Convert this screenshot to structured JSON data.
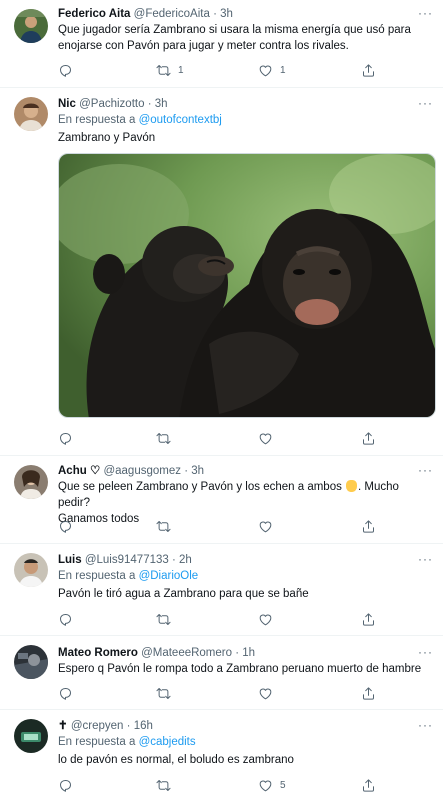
{
  "tweets": [
    {
      "name": "Federico Aita",
      "handle": "@FedericoAita",
      "time": "3h",
      "text": "Que jugador sería Zambrano si usara la misma energía que usó para enojarse con Pavón para jugar y meter contra los rivales.",
      "replies": "",
      "retweets": "1",
      "likes": "1"
    },
    {
      "name": "Nic",
      "handle": "@Pachizotto",
      "time": "3h",
      "reply_prefix": "En respuesta a",
      "reply_to": "@outofcontextbj",
      "text": "Zambrano y Pavón",
      "replies": "",
      "retweets": "",
      "likes": ""
    },
    {
      "name": "Achu ♡",
      "handle": "@aagusgomez",
      "time": "3h",
      "text_a": "Que se peleen Zambrano y Pavón y los echen a ambos",
      "text_b": ". Mucho pedir?",
      "text_c": "Ganamos todos",
      "replies": "",
      "retweets": "",
      "likes": ""
    },
    {
      "name": "Luis",
      "handle": "@Luis91477133",
      "time": "2h",
      "reply_prefix": "En respuesta a",
      "reply_to": "@DiarioOle",
      "text": "Pavón le tiró agua a Zambrano para que se bañe",
      "replies": "",
      "retweets": "",
      "likes": ""
    },
    {
      "name": "Mateo Romero",
      "handle": "@MateeeRomero",
      "time": "1h",
      "text": "Espero q Pavón le rompa todo a Zambrano peruano muerto de hambre",
      "replies": "",
      "retweets": "",
      "likes": ""
    },
    {
      "name": "✝",
      "handle": "@crepyen",
      "time": "16h",
      "reply_prefix": "En respuesta a",
      "reply_to": "@cabjedits",
      "text": "lo de pavón es normal, el boludo es zambrano",
      "replies": "",
      "retweets": "",
      "likes": "5"
    }
  ],
  "ui": {
    "dot": "·",
    "more": "···"
  },
  "colors": {
    "link": "#1d9bf0",
    "secondary": "#536471",
    "border": "#eff3f4"
  }
}
